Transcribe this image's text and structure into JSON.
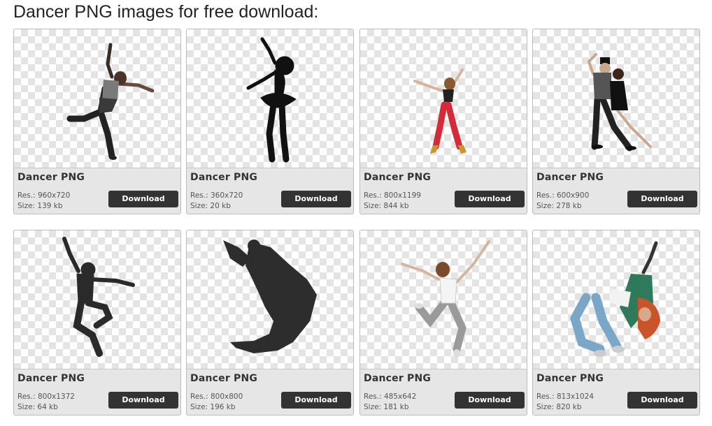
{
  "page": {
    "heading": "Dancer PNG images for free download:"
  },
  "cards": [
    {
      "title": "Dancer PNG",
      "res": "Res.: 960x720",
      "size": "Size: 139 kb",
      "button": "Download",
      "image": "female-dancer-photo"
    },
    {
      "title": "Dancer PNG",
      "res": "Res.: 360x720",
      "size": "Size: 20 kb",
      "button": "Download",
      "image": "ballerina-silhouette"
    },
    {
      "title": "Dancer PNG",
      "res": "Res.: 800x1199",
      "size": "Size: 844 kb",
      "button": "Download",
      "image": "girl-dancer-red-pants-photo"
    },
    {
      "title": "Dancer PNG",
      "res": "Res.: 600x900",
      "size": "Size: 278 kb",
      "button": "Download",
      "image": "tango-couple-photo"
    },
    {
      "title": "Dancer PNG",
      "res": "Res.: 800x1372",
      "size": "Size: 64 kb",
      "button": "Download",
      "image": "male-dancer-silhouette"
    },
    {
      "title": "Dancer PNG",
      "res": "Res.: 800x800",
      "size": "Size: 196 kb",
      "button": "Download",
      "image": "jumping-dancer-silhouette"
    },
    {
      "title": "Dancer PNG",
      "res": "Res.: 485x642",
      "size": "Size: 181 kb",
      "button": "Download",
      "image": "jumping-girl-photo"
    },
    {
      "title": "Dancer PNG",
      "res": "Res.: 813x1024",
      "size": "Size: 820 kb",
      "button": "Download",
      "image": "breakdancer-girl-photo"
    }
  ],
  "colors": {
    "button_bg": "#333333",
    "card_bg": "#e6e6e6",
    "checker": "#e4e4e4"
  }
}
